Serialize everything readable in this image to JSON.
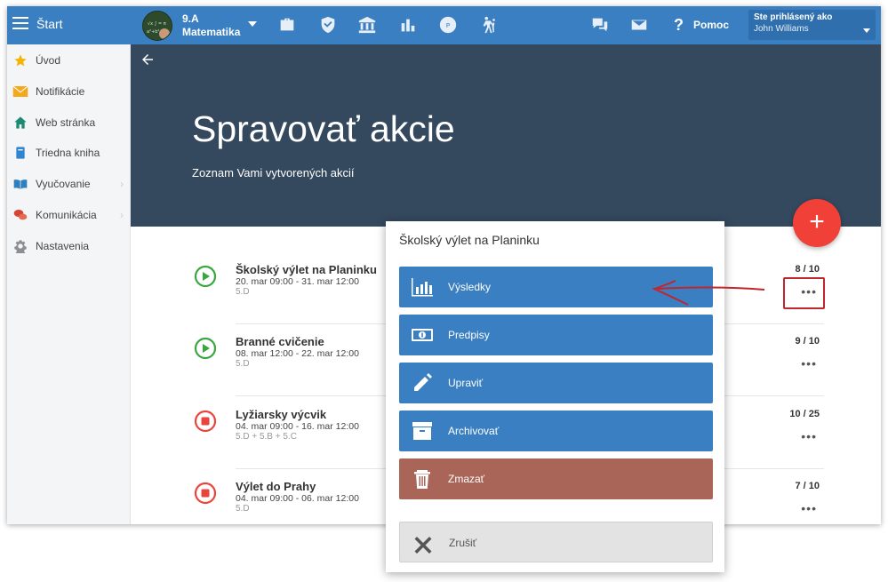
{
  "topbar": {
    "start_label": "Štart",
    "class_name": "9.A",
    "class_subject": "Matematika",
    "help_label": "Pomoc",
    "help_symbol": "?",
    "user_title": "Ste prihlásený ako",
    "user_name": "John Williams"
  },
  "sidebar": {
    "items": [
      {
        "label": "Úvod",
        "icon": "star-icon"
      },
      {
        "label": "Notifikácie",
        "icon": "envelope-icon"
      },
      {
        "label": "Web stránka",
        "icon": "home-icon"
      },
      {
        "label": "Triedna kniha",
        "icon": "book-icon"
      },
      {
        "label": "Vyučovanie",
        "icon": "open-book-icon",
        "chevron": "›"
      },
      {
        "label": "Komunikácia",
        "icon": "chat-icon",
        "chevron": "›"
      },
      {
        "label": "Nastavenia",
        "icon": "gear-icon"
      }
    ]
  },
  "hero": {
    "title": "Spravovať akcie",
    "subtitle": "Zoznam Vami vytvorených akcií"
  },
  "fab_symbol": "+",
  "events": [
    {
      "name": "Školský výlet na Planinku",
      "date": "20. mar 09:00 - 31. mar 12:00",
      "classes": "5.D",
      "score": "8 / 10",
      "status": "running",
      "more": "•••"
    },
    {
      "name": "Branné cvičenie",
      "date": "08. mar 12:00 - 22. mar 12:00",
      "classes": "5.D",
      "score": "9 / 10",
      "status": "running",
      "more": "•••"
    },
    {
      "name": "Lyžiarsky výcvik",
      "date": "04. mar 09:00 - 16. mar 12:00",
      "classes": "5.D + 5.B + 5.C",
      "score": "10 / 25",
      "status": "stopped",
      "more": "•••"
    },
    {
      "name": "Výlet do Prahy",
      "date": "04. mar 09:00 - 06. mar 12:00",
      "classes": "5.D",
      "score": "7 / 10",
      "status": "stopped",
      "more": "•••"
    }
  ],
  "popup": {
    "title": "Školský výlet na Planinku",
    "buttons": [
      {
        "label": "Výsledky",
        "icon": "bar-chart-icon"
      },
      {
        "label": "Predpisy",
        "icon": "banknote-icon"
      },
      {
        "label": "Upraviť",
        "icon": "pencil-icon"
      },
      {
        "label": "Archivovať",
        "icon": "archive-box-icon"
      },
      {
        "label": "Zmazať",
        "icon": "trash-icon"
      }
    ],
    "cancel_label": "Zrušiť"
  },
  "colors": {
    "topbar": "#3a7fc1",
    "hero": "#34485e",
    "fab": "#f04037",
    "running": "#3aa640",
    "stopped": "#e8453c",
    "delete_button": "#a96658",
    "annotation": "#c0262e"
  }
}
